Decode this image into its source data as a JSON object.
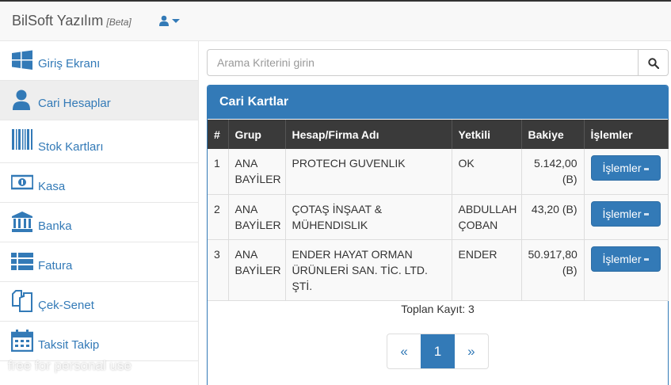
{
  "navbar": {
    "brand": "BilSoft Yazılım",
    "beta": "[Beta]"
  },
  "sidebar": {
    "items": [
      {
        "label": "Giriş Ekranı",
        "icon": "windows-icon"
      },
      {
        "label": "Cari Hesaplar",
        "icon": "user-icon"
      },
      {
        "label": "Stok Kartları",
        "icon": "barcode-icon"
      },
      {
        "label": "Kasa",
        "icon": "money-icon"
      },
      {
        "label": "Banka",
        "icon": "bank-icon"
      },
      {
        "label": "Fatura",
        "icon": "list-icon"
      },
      {
        "label": "Çek-Senet",
        "icon": "copy-icon"
      },
      {
        "label": "Taksit Takip",
        "icon": "calendar-icon"
      }
    ],
    "watermark": "free for personal use"
  },
  "search": {
    "placeholder": "Arama Kriterini girin"
  },
  "panel": {
    "title": "Cari Kartlar",
    "columns": [
      "#",
      "Grup",
      "Hesap/Firma Adı",
      "Yetkili",
      "Bakiye",
      "İşlemler"
    ],
    "rows": [
      {
        "no": "1",
        "group": "ANA BAYİLER",
        "name": "PROTECH GUVENLIK",
        "contact": "OK",
        "balance": "5.142,00 (B)",
        "action": "İşlemler"
      },
      {
        "no": "2",
        "group": "ANA BAYİLER",
        "name": "ÇOTAŞ İNŞAAT & MÜHENDISLIK",
        "contact": "ABDULLAH ÇOBAN",
        "balance": "43,20 (B)",
        "action": "İşlemler"
      },
      {
        "no": "3",
        "group": "ANA BAYİLER",
        "name": "ENDER HAYAT ORMAN ÜRÜNLERİ SAN. TİC. LTD. ŞTİ.",
        "contact": "ENDER",
        "balance": "50.917,80 (B)",
        "action": "İşlemler"
      }
    ],
    "total": "Toplan Kayıt: 3",
    "pagination": {
      "prev": "«",
      "current": "1",
      "next": "»"
    }
  },
  "colors": {
    "primary": "#337ab7",
    "header_dark": "#3a3a3a"
  }
}
